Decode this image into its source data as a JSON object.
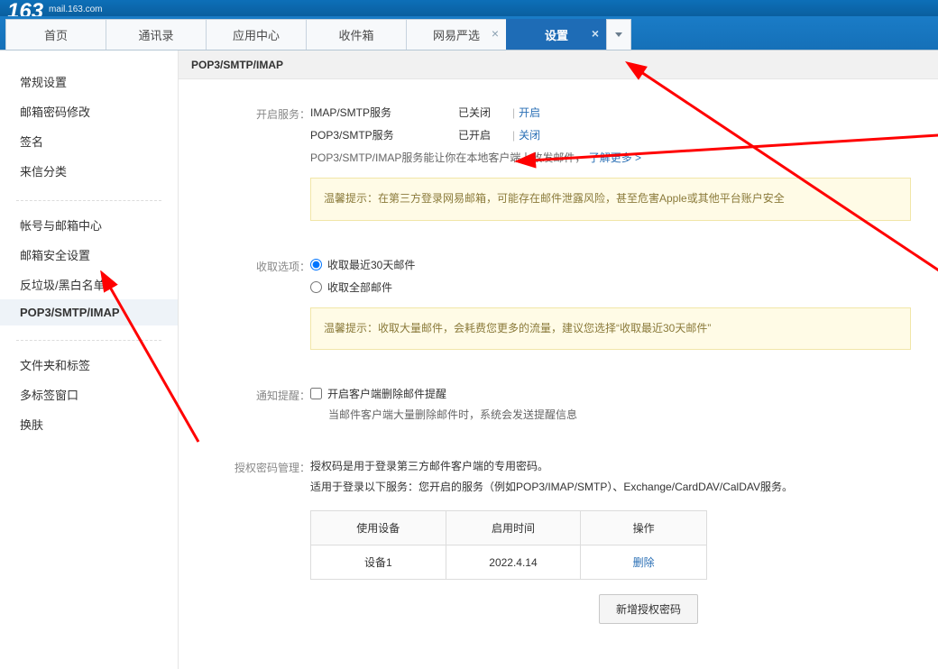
{
  "brand": {
    "name": "163",
    "sub": "mail.163.com"
  },
  "tabs": [
    {
      "label": "首页",
      "closable": false
    },
    {
      "label": "通讯录",
      "closable": false
    },
    {
      "label": "应用中心",
      "closable": false
    },
    {
      "label": "收件箱",
      "closable": false
    },
    {
      "label": "网易严选",
      "closable": true
    },
    {
      "label": "设置",
      "closable": true,
      "active": true
    }
  ],
  "sidebar": {
    "group1": [
      {
        "label": "常规设置"
      },
      {
        "label": "邮箱密码修改"
      },
      {
        "label": "签名"
      },
      {
        "label": "来信分类"
      }
    ],
    "group2": [
      {
        "label": "帐号与邮箱中心"
      },
      {
        "label": "邮箱安全设置"
      },
      {
        "label": "反垃圾/黑白名单"
      },
      {
        "label": "POP3/SMTP/IMAP",
        "active": true
      }
    ],
    "group3": [
      {
        "label": "文件夹和标签"
      },
      {
        "label": "多标签窗口"
      },
      {
        "label": "换肤"
      }
    ]
  },
  "section": {
    "title": "POP3/SMTP/IMAP"
  },
  "service": {
    "label": "开启服务：",
    "imap": {
      "name": "IMAP/SMTP服务",
      "status": "已关闭",
      "action": "开启"
    },
    "pop3": {
      "name": "POP3/SMTP服务",
      "status": "已开启",
      "action": "关闭"
    },
    "desc_a": "POP3/SMTP/IMAP服务能让你在本地客户端上收发邮件，",
    "desc_link": "了解更多 >",
    "tip": "温馨提示：在第三方登录网易邮箱，可能存在邮件泄露风险，甚至危害Apple或其他平台账户安全"
  },
  "receive": {
    "label": "收取选项：",
    "opt1": "收取最近30天邮件",
    "opt2": "收取全部邮件",
    "tip": "温馨提示：收取大量邮件，会耗费您更多的流量，建议您选择“收取最近30天邮件”"
  },
  "notify": {
    "label": "通知提醒：",
    "chk": "开启客户端删除邮件提醒",
    "desc": "当邮件客户端大量删除邮件时，系统会发送提醒信息"
  },
  "auth": {
    "label": "授权密码管理：",
    "p1": "授权码是用于登录第三方邮件客户端的专用密码。",
    "p2": "适用于登录以下服务：您开启的服务（例如POP3/IMAP/SMTP）、Exchange/CardDAV/CalDAV服务。",
    "th1": "使用设备",
    "th2": "启用时间",
    "th3": "操作",
    "td1": "设备1",
    "td2": "2022.4.14",
    "td3": "删除",
    "btn": "新增授权密码"
  }
}
